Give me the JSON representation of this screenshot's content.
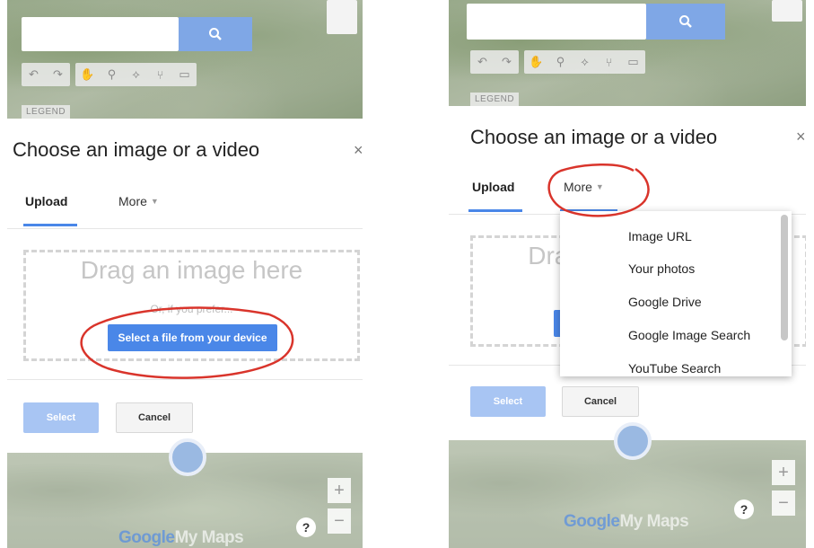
{
  "dialog": {
    "title": "Choose an image or a video",
    "close": "×",
    "tabs": {
      "upload": "Upload",
      "more": "More"
    },
    "dropzone": {
      "drag_text": "Drag an image here",
      "or_text": "Or, if you prefer...",
      "select_file_button": "Select a file from your device"
    },
    "footer": {
      "select_button": "Select",
      "cancel_button": "Cancel"
    }
  },
  "map": {
    "legend": "LEGEND",
    "logo": {
      "google": "Google",
      "mymaps": "My Maps"
    },
    "zoom_in": "+",
    "zoom_out": "−",
    "help": "?"
  },
  "more_menu": {
    "items": [
      "Image URL",
      "Your photos",
      "Google Drive",
      "Google Image Search",
      "YouTube Search"
    ]
  },
  "colors": {
    "accent": "#4a87e8",
    "accent_disabled": "#a8c5f3",
    "annotation": "#d9342b"
  },
  "icons": [
    "search-icon",
    "undo-icon",
    "redo-icon",
    "hand-icon",
    "marker-icon",
    "line-icon",
    "route-icon",
    "ruler-icon"
  ]
}
